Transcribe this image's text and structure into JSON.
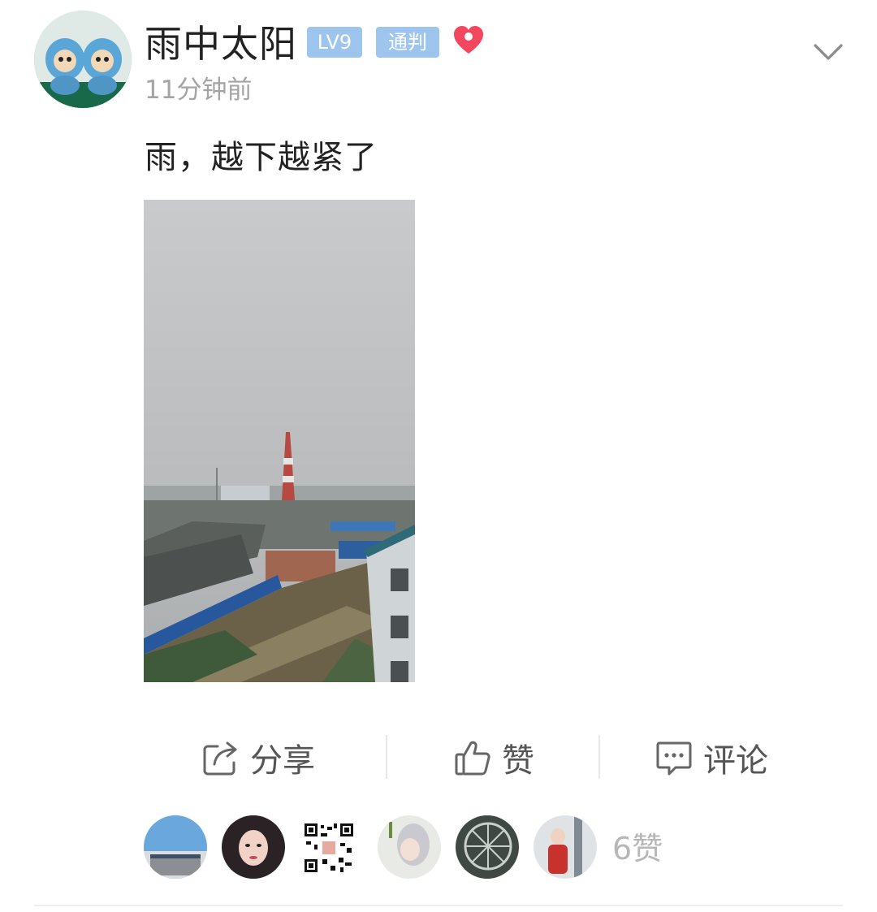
{
  "user": {
    "name": "雨中太阳",
    "level_badge": "LV9",
    "role_badge": "通判",
    "timestamp": "11分钟前"
  },
  "post": {
    "text": "雨，越下越紧了"
  },
  "actions": {
    "share_label": "分享",
    "like_label": "赞",
    "comment_label": "评论"
  },
  "likes": {
    "count_label": "6赞"
  },
  "colors": {
    "badge_blue": "#9ec5ee",
    "heart_red": "#f2475f",
    "text_dark": "#222222",
    "text_muted": "#a4a4a4"
  },
  "icons": [
    "heart-icon",
    "chevron-down-icon",
    "share-icon",
    "thumbs-up-icon",
    "comment-icon"
  ]
}
